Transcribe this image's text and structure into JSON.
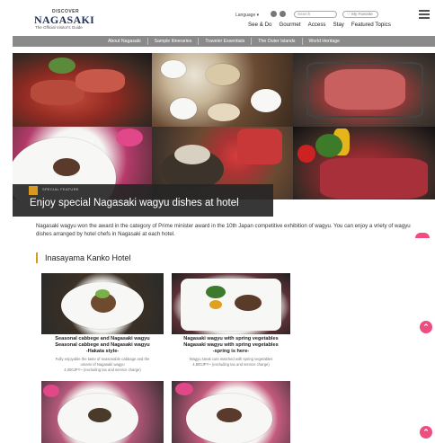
{
  "header": {
    "logo_discover": "DISCOVER",
    "logo_main": "NAGASAKI",
    "logo_sub": "The Official Visitor's Guide",
    "language_label": "Language",
    "search_placeholder": "Search",
    "favorite_label": "My Favorite",
    "subnav": [
      "See & Do",
      "Gourmet",
      "Access",
      "Stay",
      "Featured Topics"
    ]
  },
  "main_nav": [
    "About Nagasaki",
    "Sample Itineraries",
    "Traveler Essentials",
    "The Outer Islands",
    "World Heritage"
  ],
  "hero": {
    "small_label": "SPECIAL FEATURE",
    "title": "Enjoy special Nagasaki wagyu dishes at hotel"
  },
  "intro": "Nagasaki wagyu won the award in the category of Prime minister award in the 10th Japan competitive exhibition of wagyu. You can enjoy a vriety of wagyu dishes arranged by hotel chefs in Nagasaki at each hotel.",
  "section": {
    "title": "Inasayama Kanko Hotel"
  },
  "cards": [
    {
      "title_line1": "Seasonal cabbege and Nagasaki wagyu",
      "title_line2": "Seasonal cabbege and Nagasaki wagyu",
      "title_line3": "-Hakata style-",
      "desc_line1": "Fully enjoyable the taste of seasonable cabbage and the",
      "desc_line2": "umami of Nagasaki wagyu",
      "desc_line3": "4,000JPY~ (excluding tax and service charge)"
    },
    {
      "title_line1": "Nagasaki wagyu with spring vegetables",
      "title_line2": "Nagasaki wagyu with spring vegetables",
      "title_line3": "-spring is here-",
      "desc_line1": "Wagyu steak cuts matched with spring vegetables",
      "desc_line2": "4,800JPY~ (excluding tax and service charge)"
    }
  ],
  "colors": {
    "nav_gray": "#8a8a8a",
    "accent_gold": "#d89a1e",
    "pink_button": "#ee4d7f"
  },
  "icons": {
    "scroll_top": "chevron-up-icon",
    "menu": "hamburger-icon"
  }
}
